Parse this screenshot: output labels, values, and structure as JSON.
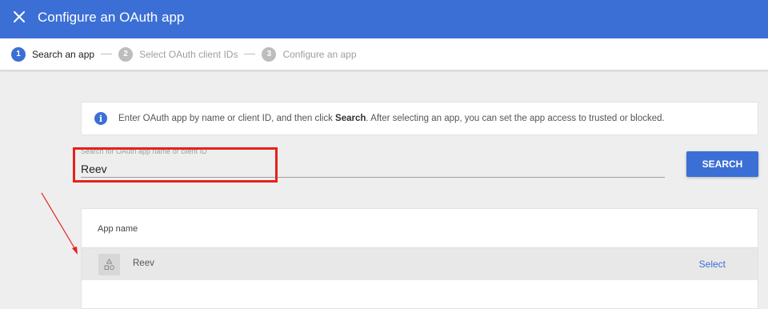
{
  "header": {
    "close_icon": "close-icon",
    "title": "Configure an OAuth app",
    "background": "#3b6fd6"
  },
  "stepper": {
    "steps": [
      {
        "number": "1",
        "label": "Search an app",
        "active": true
      },
      {
        "number": "2",
        "label": "Select OAuth client IDs",
        "active": false
      },
      {
        "number": "3",
        "label": "Configure an app",
        "active": false
      }
    ]
  },
  "info": {
    "icon": "info-icon",
    "glyph": "i",
    "text_before": "Enter OAuth app by name or client ID, and then click ",
    "text_bold": "Search",
    "text_after": ". After selecting an app, you can set the app access to trusted or blocked."
  },
  "search": {
    "placeholder": "Search for OAuth app name or client ID",
    "value": "Reev",
    "button_label": "SEARCH"
  },
  "results": {
    "column_header": "App name",
    "rows": [
      {
        "icon": "app-shapes-icon",
        "name": "Reev",
        "action": "Select"
      }
    ]
  },
  "annotations": {
    "highlight_color": "#e8201c"
  }
}
